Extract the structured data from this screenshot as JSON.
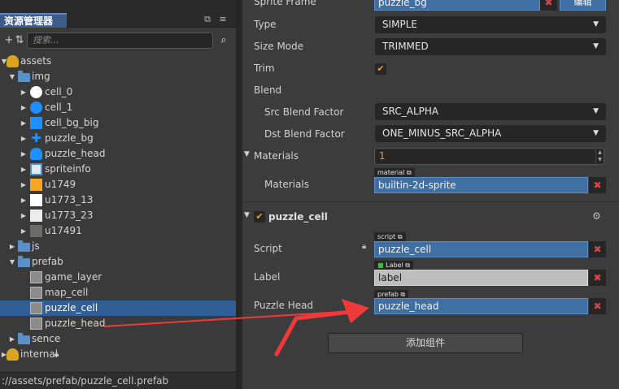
{
  "panel": {
    "tab_title": "资源管理器",
    "search_placeholder": "搜索...",
    "status_path": "://assets/prefab/puzzle_cell.prefab"
  },
  "tree": [
    {
      "label": "assets",
      "icon": "package-icon",
      "expanded": true
    },
    {
      "label": "img",
      "icon": "folder-icon",
      "expanded": true
    },
    {
      "label": "cell_0",
      "icon": "white-circle-sprite-icon"
    },
    {
      "label": "cell_1",
      "icon": "blue-circle-sprite-icon"
    },
    {
      "label": "cell_bg_big",
      "icon": "blue-square-sprite-icon"
    },
    {
      "label": "puzzle_bg",
      "icon": "blue-puzzle-sprite-icon"
    },
    {
      "label": "puzzle_head",
      "icon": "blue-shape-sprite-icon"
    },
    {
      "label": "spriteinfo",
      "icon": "spriteinfo-icon"
    },
    {
      "label": "u1749",
      "icon": "start-sprite-icon"
    },
    {
      "label": "u1773_13",
      "icon": "white-square-sprite-icon"
    },
    {
      "label": "u1773_23",
      "icon": "light-square-sprite-icon"
    },
    {
      "label": "u17491",
      "icon": "dark-square-sprite-icon"
    },
    {
      "label": "js",
      "icon": "folder-icon",
      "expanded": false
    },
    {
      "label": "prefab",
      "icon": "folder-icon",
      "expanded": true
    },
    {
      "label": "game_layer",
      "icon": "prefab-icon"
    },
    {
      "label": "map_cell",
      "icon": "prefab-icon"
    },
    {
      "label": "puzzle_cell",
      "icon": "prefab-icon",
      "selected": true
    },
    {
      "label": "puzzle_head",
      "icon": "prefab-icon"
    },
    {
      "label": "sence",
      "icon": "folder-icon",
      "expanded": false
    },
    {
      "label": "internal",
      "icon": "package-icon",
      "expanded": false,
      "locked": true
    }
  ],
  "inspector": {
    "sprite_frame": {
      "label": "Sprite Frame",
      "value": "puzzle_bg",
      "edit_label": "编辑"
    },
    "type": {
      "label": "Type",
      "value": "SIMPLE"
    },
    "size_mode": {
      "label": "Size Mode",
      "value": "TRIMMED"
    },
    "trim": {
      "label": "Trim",
      "checked": true
    },
    "blend": {
      "label": "Blend"
    },
    "src_blend": {
      "label": "Src Blend Factor",
      "value": "SRC_ALPHA"
    },
    "dst_blend": {
      "label": "Dst Blend Factor",
      "value": "ONE_MINUS_SRC_ALPHA"
    },
    "materials_count": {
      "label": "Materials",
      "value": "1"
    },
    "materials_item": {
      "label": "Materials",
      "tag": "material",
      "value": "builtin-2d-sprite"
    },
    "component": {
      "title": "puzzle_cell",
      "script": {
        "label": "Script",
        "tag": "script",
        "value": "puzzle_cell"
      },
      "label_prop": {
        "label": "Label",
        "tag": "Label",
        "value": "label"
      },
      "puzzle_head": {
        "label": "Puzzle Head",
        "tag": "prefab",
        "value": "puzzle_head"
      }
    },
    "add_component": "添加组件"
  },
  "colors": {
    "accent_blue": "#3f6fa3",
    "selection": "#2f5f95",
    "checkbox_orange": "#f0a030",
    "remove_red": "#d64545",
    "annotation_arrow": "#f03a3a"
  }
}
